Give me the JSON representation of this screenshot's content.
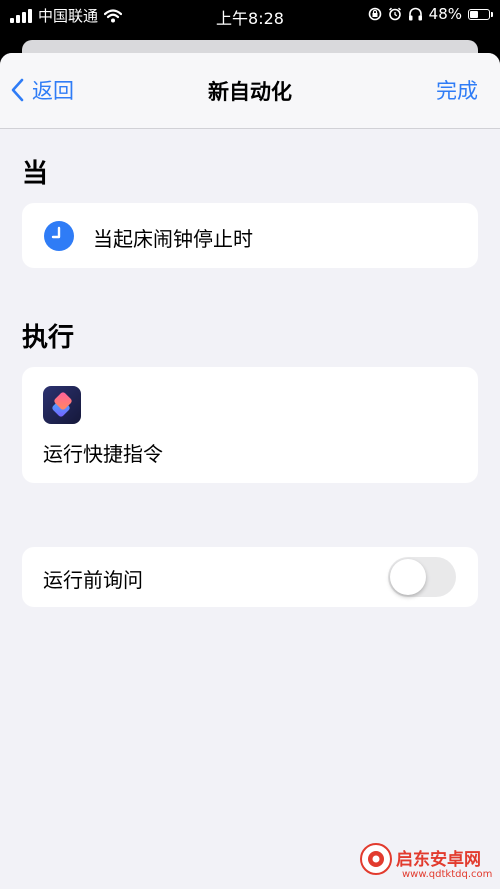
{
  "status_bar": {
    "carrier": "中国联通",
    "time": "上午8:28",
    "battery_percent": "48%",
    "battery_level": 0.48,
    "icons": [
      "signal-icon",
      "wifi-icon",
      "orientation-lock-icon",
      "alarm-icon",
      "headphones-icon",
      "battery-icon"
    ]
  },
  "nav": {
    "back_label": "返回",
    "title": "新自动化",
    "done_label": "完成",
    "accent_color": "#2f7cf6"
  },
  "trigger_section": {
    "header": "当",
    "item_label": "当起床闹钟停止时",
    "icon": "clock-icon"
  },
  "action_section": {
    "header": "执行",
    "item_label": "运行快捷指令",
    "icon": "shortcuts-app-icon"
  },
  "ask_before_running": {
    "label": "运行前询问",
    "enabled": false
  },
  "watermark": {
    "brand": "启东安卓网",
    "url": "www.qdtktdq.com"
  }
}
